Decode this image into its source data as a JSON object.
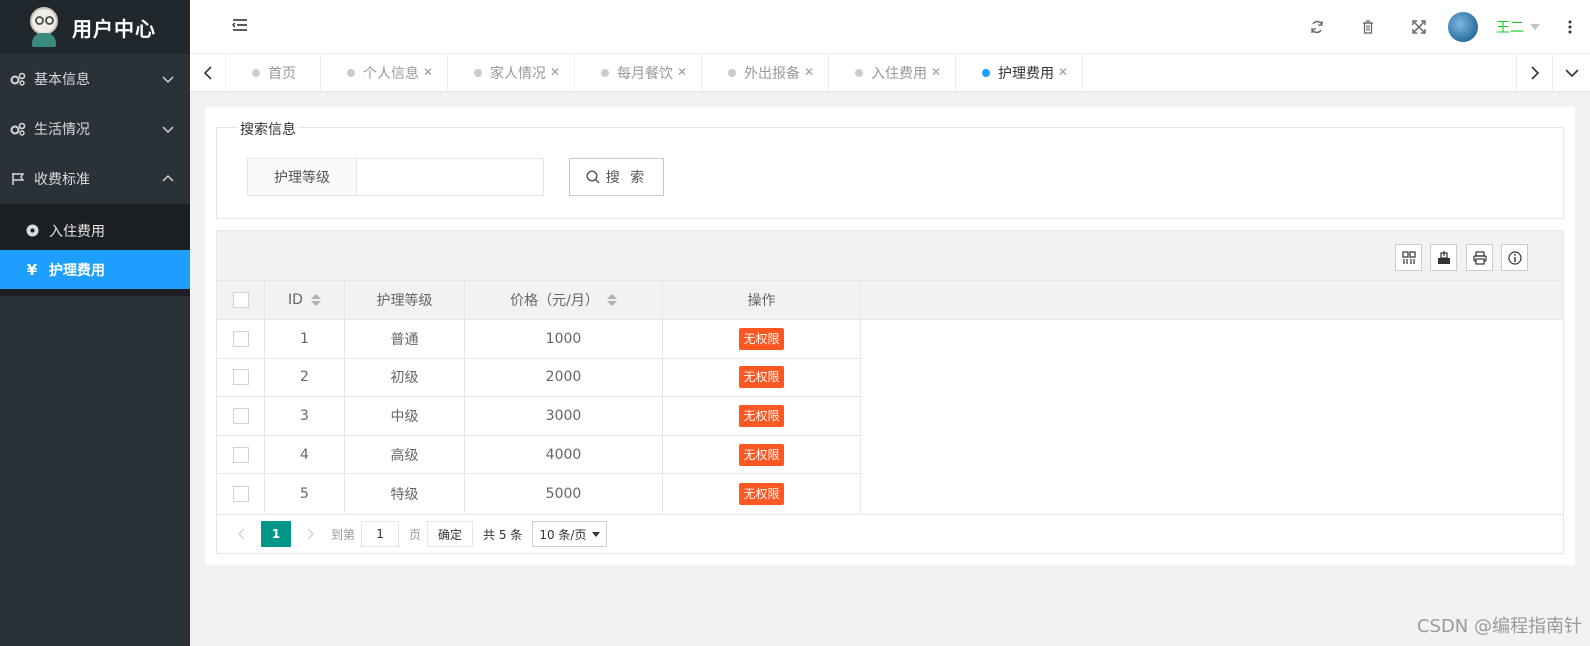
{
  "sidebar": {
    "title": "用户中心",
    "menu": [
      {
        "label": "基本信息",
        "icon": "gears-icon"
      },
      {
        "label": "生活情况",
        "icon": "gears-icon"
      },
      {
        "label": "收费标准",
        "icon": "flag-icon"
      }
    ],
    "submenu": [
      {
        "label": "入住费用",
        "icon": "dot-circle-icon"
      },
      {
        "label": "护理费用",
        "icon": "yen-icon",
        "active": true
      }
    ]
  },
  "header": {
    "user_name": "王二"
  },
  "tabs": [
    {
      "label": "首页"
    },
    {
      "label": "个人信息"
    },
    {
      "label": "家人情况"
    },
    {
      "label": "每月餐饮"
    },
    {
      "label": "外出报备"
    },
    {
      "label": "入住费用"
    },
    {
      "label": "护理费用",
      "active": true
    }
  ],
  "search": {
    "legend": "搜索信息",
    "field_label": "护理等级",
    "field_value": "",
    "button_label": "搜 索"
  },
  "table": {
    "columns": [
      "ID",
      "护理等级",
      "价格（元/月）",
      "操作"
    ],
    "rows": [
      {
        "id": "1",
        "level": "普通",
        "price": "1000",
        "action": "无权限"
      },
      {
        "id": "2",
        "level": "初级",
        "price": "2000",
        "action": "无权限"
      },
      {
        "id": "3",
        "level": "中级",
        "price": "3000",
        "action": "无权限"
      },
      {
        "id": "4",
        "level": "高级",
        "price": "4000",
        "action": "无权限"
      },
      {
        "id": "5",
        "level": "特级",
        "price": "5000",
        "action": "无权限"
      }
    ]
  },
  "pager": {
    "current": "1",
    "goto_label": "到第",
    "goto_value": "1",
    "page_label": "页",
    "confirm": "确定",
    "total": "共 5 条",
    "page_size": "10 条/页"
  },
  "watermark": "CSDN @编程指南针",
  "colors": {
    "sidebar_bg": "#2a3238",
    "active_blue": "#1e9fff",
    "badge": "#ff5722",
    "pager_active": "#009688",
    "username": "#20c520"
  }
}
